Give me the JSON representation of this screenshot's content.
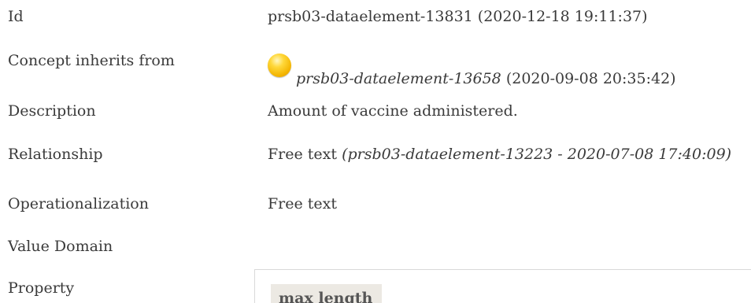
{
  "rows": {
    "id": {
      "label": "Id",
      "value": "prsb03-dataelement-13831 (2020-12-18 19:11:37)"
    },
    "inherits": {
      "label": "Concept inherits from",
      "link": "prsb03-dataelement-13658",
      "date": " (2020-09-08 20:35:42)",
      "icon": "status-orb-yellow"
    },
    "description": {
      "label": "Description",
      "value": "Amount of vaccine administered."
    },
    "relationship": {
      "label": "Relationship",
      "value": "Free text ",
      "ref": "(prsb03-dataelement-13223 - 2020-07-08 17:40:09)"
    },
    "operationalization": {
      "label": "Operationalization",
      "value": "Free text"
    },
    "value_domain": {
      "label": "Value Domain"
    },
    "property": {
      "label": "Property",
      "header": "max length"
    }
  }
}
